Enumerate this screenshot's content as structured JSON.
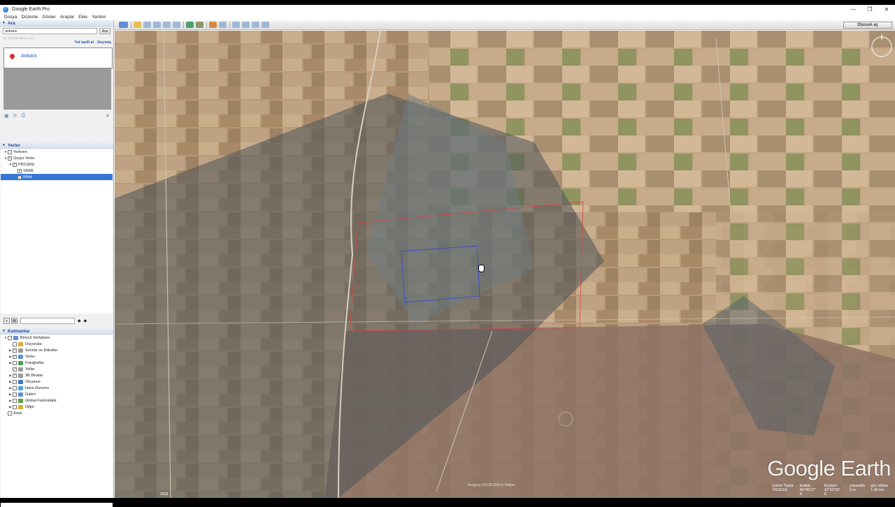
{
  "window": {
    "title": "Google Earth Pro",
    "controls": [
      "—",
      "❐",
      "✕"
    ]
  },
  "menu": [
    "Dosya",
    "Düzenle",
    "Göster",
    "Araçlar",
    "Ekle",
    "Yardım"
  ],
  "search": {
    "header": "Ara",
    "value": "ankara",
    "button": "Ara",
    "hint": "ör. Ankara sana 1,4 b",
    "links": [
      "Yol tarifi al",
      "Geçmiş"
    ],
    "results": [
      {
        "name": "Ankara"
      }
    ]
  },
  "places": {
    "header": "Yerler",
    "items": [
      {
        "label": "Yerlerim",
        "level": 1,
        "expand": "▼",
        "checked": ""
      },
      {
        "label": "Geçici Yerler",
        "level": 1,
        "expand": "▼",
        "checked": "✓"
      },
      {
        "label": "PROJEM",
        "level": 2,
        "expand": "▼",
        "checked": "✓"
      },
      {
        "label": "SINIR",
        "level": 3,
        "expand": "",
        "checked": "✓"
      },
      {
        "label": "BİNA",
        "level": 3,
        "expand": "",
        "checked": "✓",
        "selected": true
      }
    ]
  },
  "layers": {
    "header": "Katmanlar",
    "items": [
      {
        "label": "Birincil Veritabanı",
        "level": 1,
        "expand": "▼",
        "checked": "",
        "color": "#5e8fd6"
      },
      {
        "label": "Duyurular",
        "level": 2,
        "expand": "",
        "checked": "",
        "color": "#e0b030"
      },
      {
        "label": "Sınırlar ve Etiketler",
        "level": 2,
        "expand": "▶",
        "checked": "✓",
        "color": "#9a9a9a"
      },
      {
        "label": "Yerler",
        "level": 2,
        "expand": "▶",
        "checked": "✓",
        "color": "#5e8fd6"
      },
      {
        "label": "Fotoğraflar",
        "level": 2,
        "expand": "▶",
        "checked": "",
        "color": "#4aa04a"
      },
      {
        "label": "Yollar",
        "level": 2,
        "expand": "",
        "checked": "✓",
        "color": "#9a9a9a"
      },
      {
        "label": "3B Binalar",
        "level": 2,
        "expand": "▶",
        "checked": "✓",
        "color": "#9a9a9a"
      },
      {
        "label": "Okyanus",
        "level": 2,
        "expand": "▶",
        "checked": "",
        "color": "#3a7ad0"
      },
      {
        "label": "Hava Durumu",
        "level": 2,
        "expand": "▶",
        "checked": "",
        "color": "#4aa0e0"
      },
      {
        "label": "Galeri",
        "level": 2,
        "expand": "▶",
        "checked": "",
        "color": "#5e8fd6"
      },
      {
        "label": "Global Farkındalık",
        "level": 2,
        "expand": "▶",
        "checked": "",
        "color": "#5ea04a"
      },
      {
        "label": "Diğer",
        "level": 2,
        "expand": "▶",
        "checked": "",
        "color": "#e0b030"
      },
      {
        "label": "Arazi",
        "level": 1,
        "expand": "",
        "checked": "",
        "color": ""
      }
    ]
  },
  "toolbar": {
    "signin": "Oturum aç"
  },
  "map": {
    "watermark": "Google Earth",
    "imagery_credit": "Imagery ©2018 CNES / Airbus",
    "year": "2018",
    "status": [
      "Çekim Tarihi: 7/6/2018",
      "Enlem 40°00'27\" K",
      "Boylam 32°52'26\" D",
      "yükseklik 0 m",
      "göz irtifası 1,40 km"
    ]
  }
}
